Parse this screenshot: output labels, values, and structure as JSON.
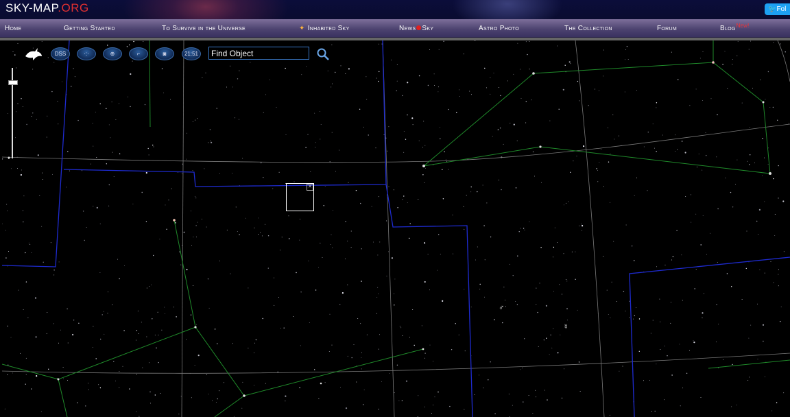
{
  "header": {
    "logo_main": "SKY-MAP",
    "logo_ext": ".ORG",
    "follow_label": "Fol"
  },
  "nav": {
    "items": [
      {
        "label": "Home"
      },
      {
        "label": "Getting Started"
      },
      {
        "label": "To Survive in the Universe"
      },
      {
        "label": "Inhabited Sky"
      },
      {
        "label": "News",
        "label2": "Sky"
      },
      {
        "label": "Astro Photo"
      },
      {
        "label": "The Collection"
      },
      {
        "label": "Forum"
      },
      {
        "label": "Blog",
        "badge": "New!"
      }
    ]
  },
  "toolbar": {
    "dss_label": "DSS",
    "time_label": "21:51",
    "find_placeholder": "Find Object"
  },
  "sky": {
    "planets": [
      {
        "name": "mars",
        "symbol": "♂"
      },
      {
        "name": "mercury",
        "symbol": "☿"
      }
    ]
  },
  "colors": {
    "header_bg": "#0b0d3a",
    "nav_bg": "#5b4f80",
    "logo_accent": "#e03030",
    "constellation_line": "#1f8a2a",
    "boundary_line": "#1e2bd0",
    "grid_line": "#7a7a7a",
    "twitter": "#1da1f2"
  }
}
